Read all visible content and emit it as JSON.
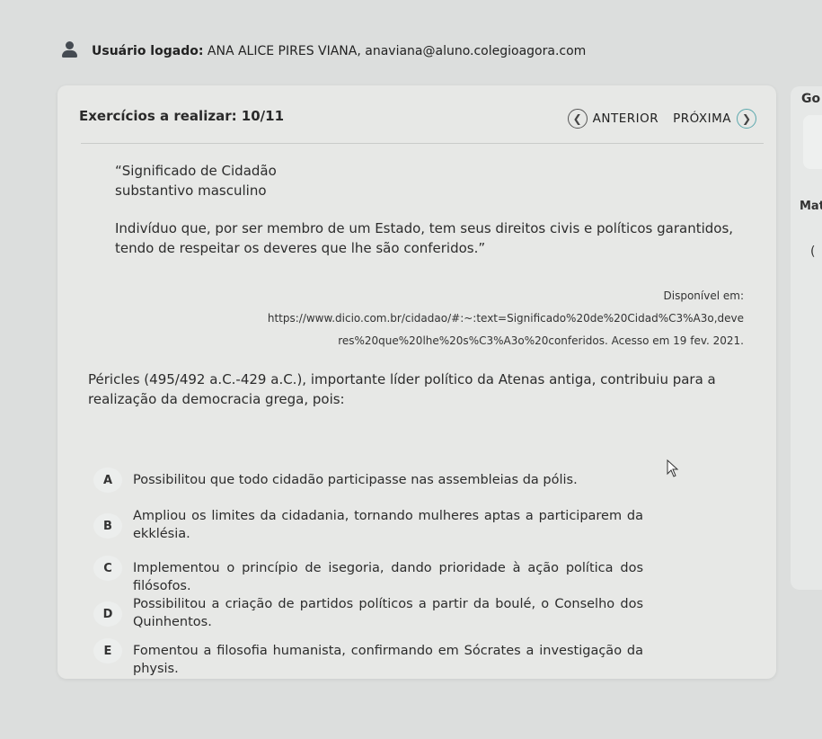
{
  "user": {
    "label": "Usuário logado:",
    "value": "ANA ALICE PIRES VIANA, anaviana@aluno.colegioagora.com"
  },
  "right_panel": {
    "t1": "Go",
    "t2": "Mat",
    "t3": "("
  },
  "header": {
    "exercise_count": "Exercícios a realizar: 10/11",
    "prev_label": "ANTERIOR",
    "next_label": "PRÓXIMA",
    "prev_icon": "chevron-left-icon",
    "next_icon": "chevron-right-icon"
  },
  "quote": {
    "line1": "“Significado de Cidadão",
    "line2": "substantivo masculino",
    "body": "Indivíduo que, por ser membro de um Estado, tem seus direitos civis e políticos garantidos, tendo de respeitar os deveres que lhe são conferidos.”"
  },
  "source": {
    "line1": "Disponível em:",
    "line2": "https://www.dicio.com.br/cidadao/#:~:text=Significado%20de%20Cidad%C3%A3o,deve",
    "line3": "res%20que%20lhe%20s%C3%A3o%20conferidos. Acesso em 19 fev. 2021."
  },
  "question": "Péricles (495/492 a.C.-429 a.C.), importante líder político da Atenas antiga, contribuiu para a realização da democracia grega, pois:",
  "options": [
    {
      "letter": "A",
      "text": "Possibilitou que todo cidadão participasse nas assembleias da pólis."
    },
    {
      "letter": "B",
      "text": "Ampliou os limites da cidadania, tornando mulheres aptas a participarem da ekklésia."
    },
    {
      "letter": "C",
      "text": "Implementou o princípio de isegoria, dando prioridade à ação política dos filósofos."
    },
    {
      "letter": "D",
      "text": "Possibilitou a criação de partidos políticos a partir da boulé, o Conselho dos Quinhentos."
    },
    {
      "letter": "E",
      "text": "Fomentou a filosofia humanista, confirmando em Sócrates a investigação da physis."
    }
  ]
}
